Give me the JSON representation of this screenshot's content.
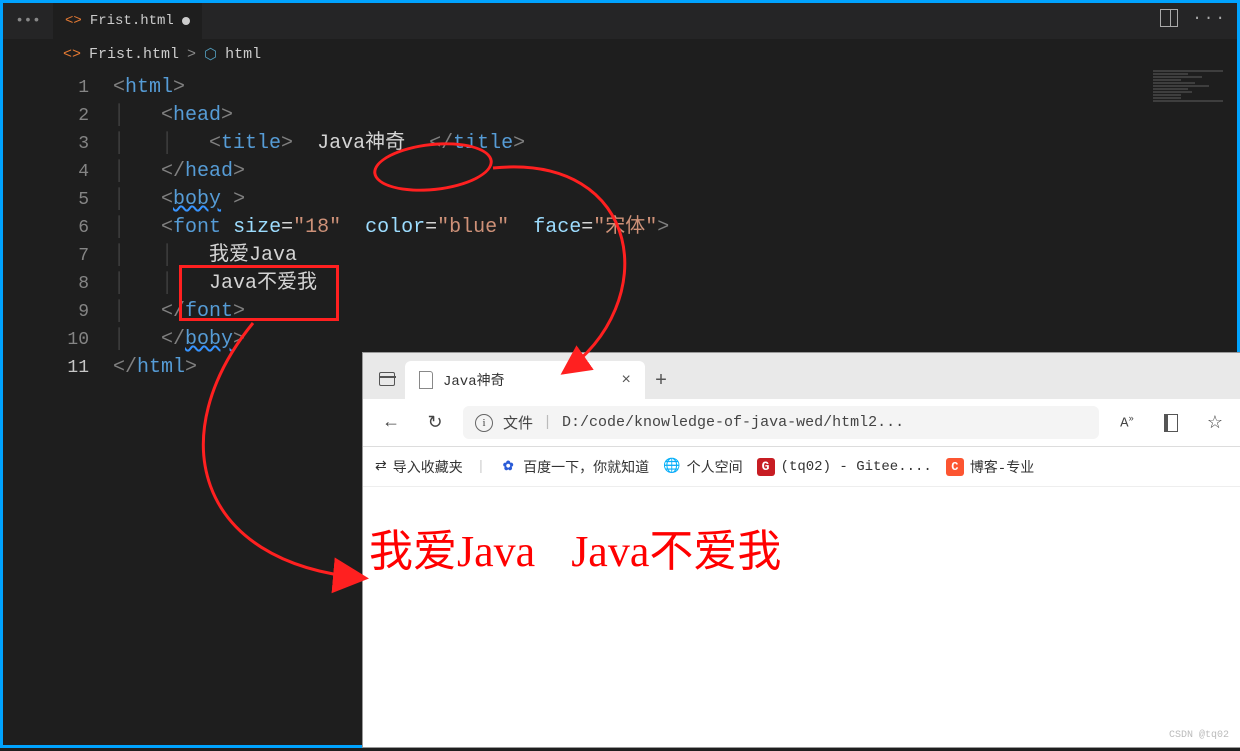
{
  "tab": {
    "filename": "Frist.html"
  },
  "breadcrumb": {
    "file": "Frist.html",
    "node": "html"
  },
  "lines": {
    "l1": "1",
    "l2": "2",
    "l3": "3",
    "l4": "4",
    "l5": "5",
    "l6": "6",
    "l7": "7",
    "l8": "8",
    "l9": "9",
    "l10": "10",
    "l11": "11"
  },
  "code": {
    "html_open": "html",
    "head_open": "head",
    "title_open": "title",
    "title_close": "title",
    "title_text": "Java神奇",
    "head_close": "head",
    "boby_open": "boby",
    "boby_space": " ",
    "font_open": "font",
    "attr_size": "size",
    "val_size": "\"18\"",
    "attr_color": "color",
    "val_color": "\"blue\"",
    "attr_face": "face",
    "val_face": "\"宋体\"",
    "txt7": "我爱Java",
    "txt8": "Java不爱我",
    "font_close": "font",
    "boby_close": "boby",
    "html_close": "html"
  },
  "browser": {
    "tab_title": "Java神奇",
    "addr_type": "文件",
    "addr_path": "D:/code/knowledge-of-java-wed/html2...",
    "addr_aa": "A",
    "bm_import": "导入收藏夹",
    "bm_baidu": "百度一下，你就知道",
    "bm_space": "个人空间",
    "bm_gitee": "(tq02) - Gitee....",
    "bm_csdn": "博客-专业",
    "page_text1": "我爱Java",
    "page_text2": "Java不爱我"
  },
  "watermark": "CSDN @tq02"
}
